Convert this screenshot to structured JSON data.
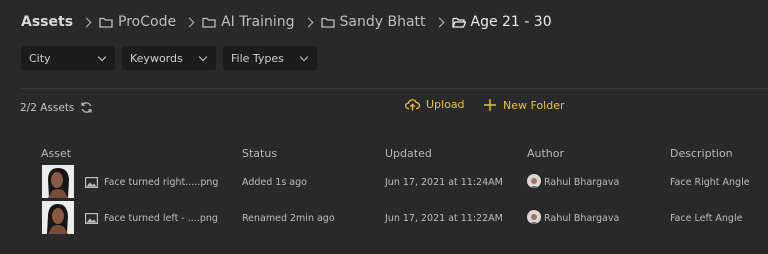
{
  "breadcrumb": {
    "root": "Assets",
    "items": [
      {
        "label": "ProCode"
      },
      {
        "label": "AI Training"
      },
      {
        "label": "Sandy Bhatt"
      },
      {
        "label": "Age 21 - 30"
      }
    ]
  },
  "filters": [
    {
      "label": "City"
    },
    {
      "label": "Keywords"
    },
    {
      "label": "File Types"
    }
  ],
  "toolbar": {
    "count": "2/2 Assets",
    "upload_label": "Upload",
    "new_folder_label": "New Folder",
    "accent_color": "#e8c23a"
  },
  "table": {
    "headers": {
      "asset": "Asset",
      "status": "Status",
      "updated": "Updated",
      "author": "Author",
      "description": "Description"
    },
    "rows": [
      {
        "name": "Face turned right.....png",
        "status": "Added 1s ago",
        "updated": "Jun 17, 2021 at 11:24AM",
        "author": "Rahul Bhargava",
        "description": "Face Right Angle"
      },
      {
        "name": "Face turned left - ....png",
        "status": "Renamed 2min ago",
        "updated": "Jun 17, 2021 at 11:22AM",
        "author": "Rahul Bhargava",
        "description": "Face Left Angle"
      }
    ]
  }
}
